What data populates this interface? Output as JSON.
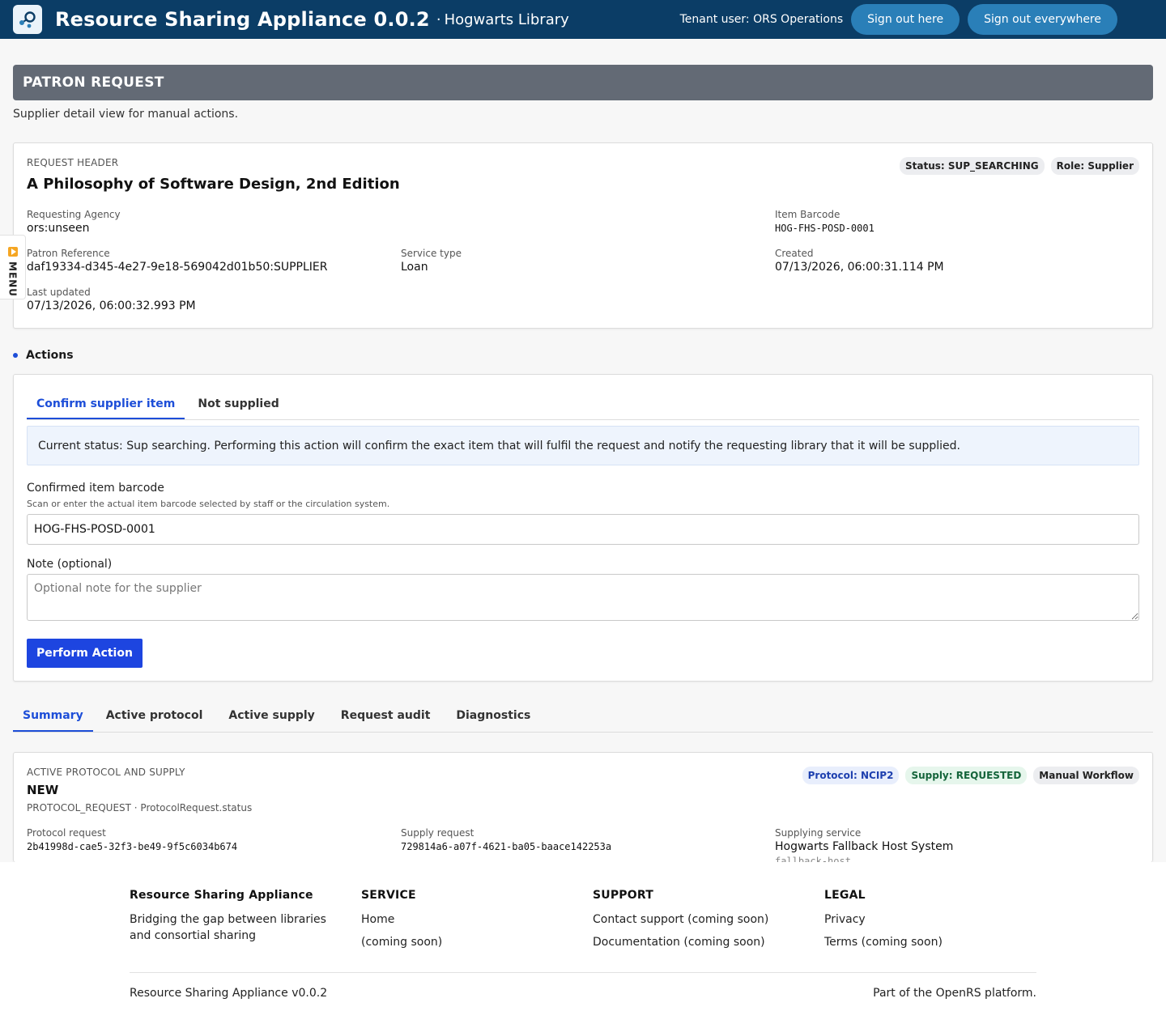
{
  "topbar": {
    "app_title": "Resource Sharing Appliance 0.0.2",
    "tenant_separator": "·",
    "tenant_name": "Hogwarts Library",
    "tenant_user": "Tenant user: ORS Operations",
    "sign_out_here": "Sign out here",
    "sign_out_everywhere": "Sign out everywhere"
  },
  "menu": {
    "label": "MENU"
  },
  "page": {
    "heading": "PATRON REQUEST",
    "subtitle": "Supplier detail view for manual actions."
  },
  "request_header": {
    "eyebrow": "REQUEST HEADER",
    "title": "A Philosophy of Software Design, 2nd Edition",
    "badges": [
      "Status: SUP_SEARCHING",
      "Role: Supplier"
    ],
    "fields": {
      "requesting_agency": {
        "label": "Requesting Agency",
        "value": "ors:unseen"
      },
      "item_barcode": {
        "label": "Item Barcode",
        "value": "HOG-FHS-POSD-0001"
      },
      "patron_reference": {
        "label": "Patron Reference",
        "value": "daf19334-d345-4e27-9e18-569042d01b50:SUPPLIER"
      },
      "service_type": {
        "label": "Service type",
        "value": "Loan"
      },
      "created": {
        "label": "Created",
        "value": "07/13/2026, 06:00:31.114 PM"
      },
      "last_updated": {
        "label": "Last updated",
        "value": "07/13/2026, 06:00:32.993 PM"
      }
    }
  },
  "actions": {
    "heading": "Actions",
    "tabs": [
      "Confirm supplier item",
      "Not supplied"
    ],
    "info": "Current status: Sup searching. Performing this action will confirm the exact item that will fulfil the request and notify the requesting library that it will be supplied.",
    "barcode_label": "Confirmed item barcode",
    "barcode_hint": "Scan or enter the actual item barcode selected by staff or the circulation system.",
    "barcode_value": "HOG-FHS-POSD-0001",
    "note_label": "Note (optional)",
    "note_placeholder": "Optional note for the supplier",
    "perform_button": "Perform Action"
  },
  "lower_tabs": [
    "Summary",
    "Active protocol",
    "Active supply",
    "Request audit",
    "Diagnostics"
  ],
  "summary": {
    "eyebrow": "ACTIVE PROTOCOL AND SUPPLY",
    "title": "NEW",
    "meta": "PROTOCOL_REQUEST · ProtocolRequest.status",
    "badges": [
      "Protocol: NCIP2",
      "Supply: REQUESTED",
      "Manual Workflow"
    ],
    "fields": {
      "protocol_request": {
        "label": "Protocol request",
        "value": "2b41998d-cae5-32f3-be49-9f5c6034b674"
      },
      "supply_request": {
        "label": "Supply request",
        "value": "729814a6-a07f-4621-ba05-baace142253a"
      },
      "supplying_service": {
        "label": "Supplying service",
        "value": "Hogwarts Fallback Host System",
        "code": "fallback-host"
      }
    }
  },
  "footer": {
    "brand_heading": "Resource Sharing Appliance",
    "brand_text": "Bridging the gap between libraries and consortial sharing",
    "service_heading": "SERVICE",
    "service_links": [
      "Home",
      "(coming soon)"
    ],
    "support_heading": "SUPPORT",
    "support_links": [
      "Contact support (coming soon)",
      "Documentation (coming soon)"
    ],
    "legal_heading": "LEGAL",
    "legal_links": [
      "Privacy",
      "Terms (coming soon)"
    ],
    "version": "Resource Sharing Appliance v0.0.2",
    "platform": "Part of the OpenRS platform."
  },
  "colors": {
    "topbar": "#0b3d66",
    "accent": "#1d4ed8",
    "heading_bar": "#636a75"
  }
}
